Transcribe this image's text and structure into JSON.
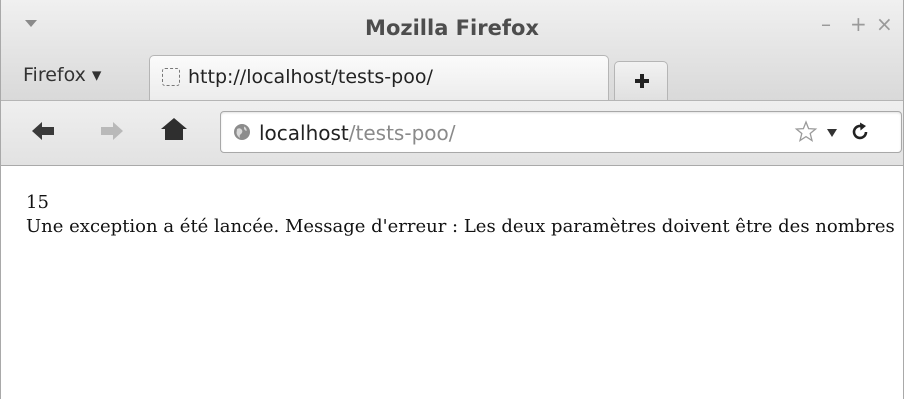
{
  "window": {
    "title": "Mozilla Firefox",
    "controls": {
      "minimize": "–",
      "maximize": "+",
      "close": "×"
    }
  },
  "tabstrip": {
    "menu_label": "Firefox ▾",
    "tab": {
      "title": "http://localhost/tests-poo/",
      "favicon": "blank-page-icon"
    },
    "new_tab_icon": "plus-icon"
  },
  "navbar": {
    "back_icon": "back-arrow-icon",
    "forward_icon": "forward-arrow-icon",
    "home_icon": "home-icon",
    "url": {
      "host": "localhost",
      "path": "/tests-poo/"
    },
    "site_icon": "globe-icon",
    "bookmark_icon": "star-icon",
    "reload_icon": "reload-icon"
  },
  "content": {
    "line1": "15",
    "line2": "Une exception a été lancée. Message d'erreur : Les deux paramètres doivent être des nombres"
  }
}
